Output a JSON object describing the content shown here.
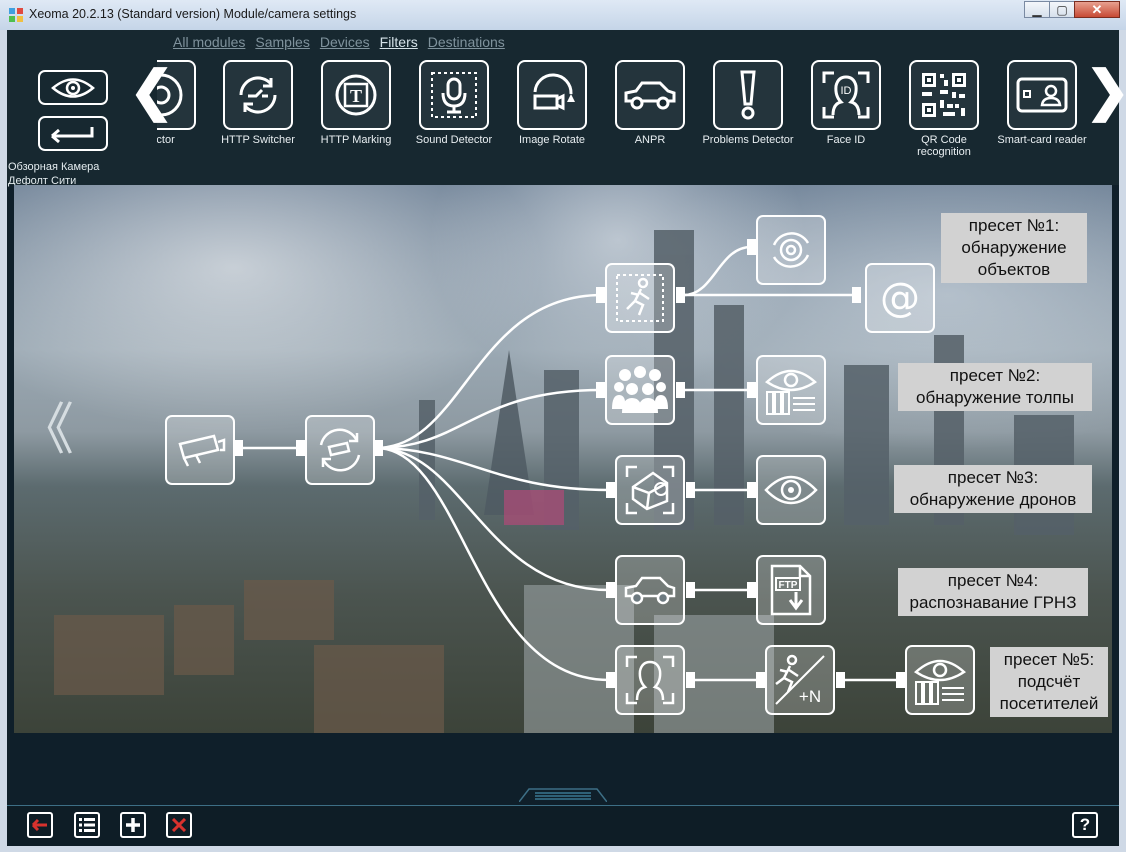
{
  "window": {
    "title": "Xeoma 20.2.13 (Standard version) Module/camera settings",
    "controls": [
      "minimize-icon",
      "maximize-icon",
      "close-icon"
    ]
  },
  "nav": {
    "tabs": [
      "All modules",
      "Samples",
      "Devices",
      "Filters",
      "Destinations"
    ],
    "active": "Filters"
  },
  "camera": {
    "label_line1": "Обзорная Камера",
    "label_line2": "Дефолт Сити"
  },
  "palette": {
    "items": [
      {
        "label": "tector",
        "icon": "detector-partial-icon"
      },
      {
        "label": "HTTP Switcher",
        "icon": "http-switcher-icon"
      },
      {
        "label": "HTTP Marking",
        "icon": "http-marking-icon"
      },
      {
        "label": "Sound Detector",
        "icon": "microphone-icon"
      },
      {
        "label": "Image Rotate",
        "icon": "image-rotate-icon"
      },
      {
        "label": "ANPR",
        "icon": "car-icon"
      },
      {
        "label": "Problems Detector",
        "icon": "exclamation-icon"
      },
      {
        "label": "Face ID",
        "icon": "face-id-icon"
      },
      {
        "label": "QR Code recognition",
        "icon": "qr-code-icon"
      },
      {
        "label": "Smart-card reader",
        "icon": "smart-card-icon"
      }
    ]
  },
  "presets": {
    "p1": "пресет №1:\nобнаружение\nобъектов",
    "p2": "пресет №2:\nобнаружение толпы",
    "p3": "пресет №3:\nобнаружение дронов",
    "p4": "пресет №4:\nраспознавание ГРНЗ",
    "p5": "пресет №5:\nподсчёт\nпосетителей"
  },
  "nodes": {
    "source": "camera-icon",
    "rotate": "image-rotate-icon",
    "motion": "motion-detector-icon",
    "crowd": "crowd-icon",
    "drone": "drone-detector-icon",
    "anpr": "car-icon",
    "face": "face-detector-icon",
    "archive1": "archive-icon",
    "email": "email-icon",
    "archive2": "archive-icon",
    "eye": "eye-icon",
    "ftp": "ftp-icon",
    "counter": "visitor-counter-icon",
    "archive3": "archive-icon",
    "counter_label": "+N",
    "ftp_label": "FTP",
    "email_label": "@"
  },
  "colors": {
    "accent": "#3d6f86",
    "background": "#0f1f2a",
    "close_red": "#c74a34",
    "toolbar_red": "#d8322e"
  }
}
